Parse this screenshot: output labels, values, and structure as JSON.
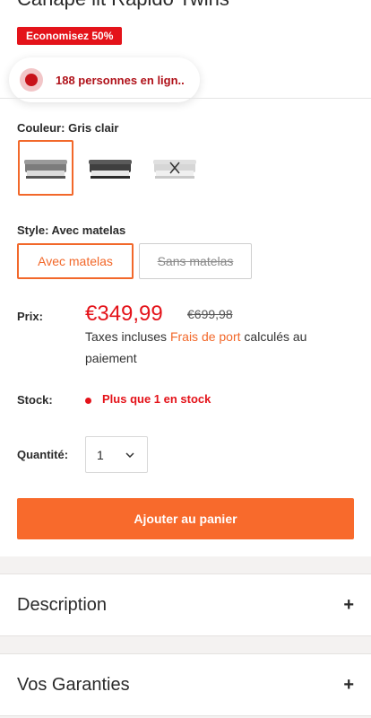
{
  "product": {
    "title": "Canapé lit Rapido Twins",
    "discount_badge": "Economisez 50%",
    "online_text": "188 personnes en lign.."
  },
  "color": {
    "label": "Couleur:",
    "selected": "Gris clair",
    "swatches": [
      "Gris clair",
      "Gris foncé",
      "Blanc (indisponible)"
    ]
  },
  "style": {
    "label": "Style:",
    "selected": "Avec matelas",
    "options": [
      "Avec matelas",
      "Sans matelas"
    ]
  },
  "price": {
    "label": "Prix:",
    "current": "€349,99",
    "original": "€699,98",
    "tax_before": "Taxes incluses ",
    "tax_link": "Frais de port",
    "tax_after": " calculés au paiement"
  },
  "stock": {
    "label": "Stock:",
    "text": "Plus que 1 en stock"
  },
  "quantity": {
    "label": "Quantité:",
    "value": "1"
  },
  "cart": {
    "button_label": "Ajouter au panier"
  },
  "accordions": [
    {
      "title": "Description",
      "icon": "+"
    },
    {
      "title": "Vos Garanties",
      "icon": "+"
    }
  ],
  "colors": {
    "accent": "#f86a2c",
    "sale": "#e4131a"
  }
}
